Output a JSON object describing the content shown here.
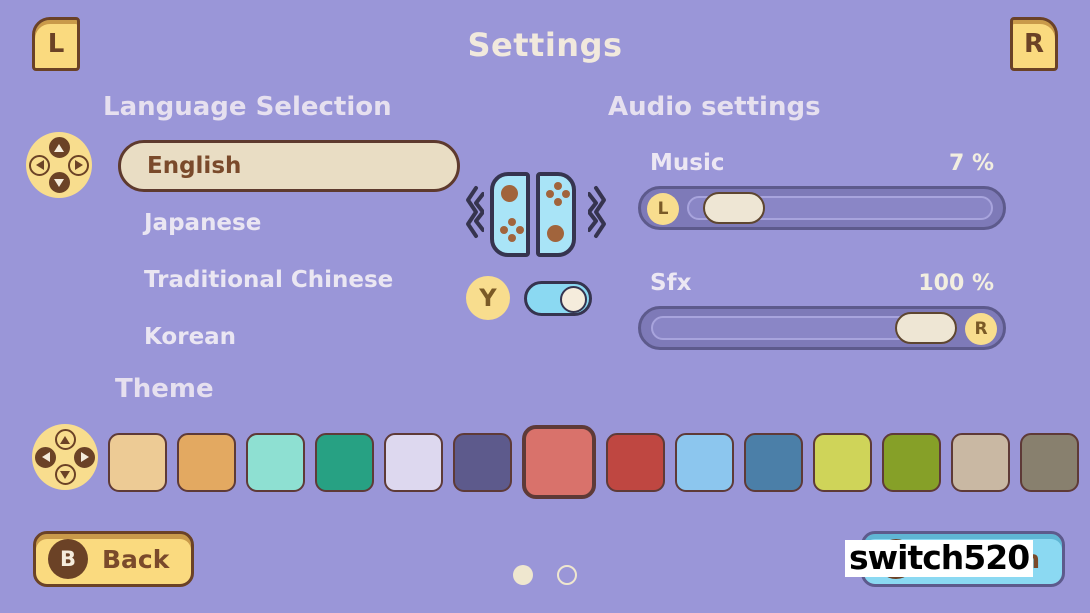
{
  "header": {
    "title": "Settings",
    "left_shoulder": "L",
    "right_shoulder": "R"
  },
  "language_section": {
    "title": "Language Selection",
    "dpad_icon": "dpad-vertical-icon",
    "items": [
      {
        "label": "English",
        "selected": true
      },
      {
        "label": "Japanese",
        "selected": false
      },
      {
        "label": "Traditional Chinese",
        "selected": false
      },
      {
        "label": "Korean",
        "selected": false
      }
    ]
  },
  "rumble": {
    "icon": "joycon-vibration-icon",
    "button_badge": "Y",
    "toggle_state": "on",
    "toggle_color": "#8bd9f2"
  },
  "audio_section": {
    "title": "Audio settings",
    "sliders": [
      {
        "name": "Music",
        "value_label": "7 %",
        "value": 7,
        "badge": "L",
        "badge_side": "left"
      },
      {
        "name": "Sfx",
        "value_label": "100 %",
        "value": 100,
        "badge": "R",
        "badge_side": "right"
      }
    ]
  },
  "theme_section": {
    "title": "Theme",
    "dpad_icon": "dpad-horizontal-icon",
    "selected_index": 6,
    "swatches": [
      {
        "color": "#edcb95"
      },
      {
        "color": "#e3a961"
      },
      {
        "color": "#8ee0d2"
      },
      {
        "color": "#27a183"
      },
      {
        "color": "#ddd8ef"
      },
      {
        "color": "#5d5a8c"
      },
      {
        "color": "#d9726b"
      },
      {
        "color": "#bf4741"
      },
      {
        "color": "#8cc6ee"
      },
      {
        "color": "#4b7fa8"
      },
      {
        "color": "#cfd459"
      },
      {
        "color": "#86a028"
      },
      {
        "color": "#c9b8a3"
      },
      {
        "color": "#88806e"
      }
    ]
  },
  "footer": {
    "back": {
      "key": "B",
      "label": "Back"
    },
    "confirm": {
      "key": "A",
      "label": "Confirm"
    },
    "pages": [
      {
        "active": true
      },
      {
        "active": false
      }
    ]
  },
  "watermark": {
    "text": "switch520"
  },
  "palette": {
    "background": "#9a96d8",
    "accent_yellow": "#fada7f",
    "accent_brown": "#6b4226",
    "cream": "#f1e9dd",
    "slider_track": "#7e7ab8",
    "joycon_blue": "#a9e4f7"
  }
}
